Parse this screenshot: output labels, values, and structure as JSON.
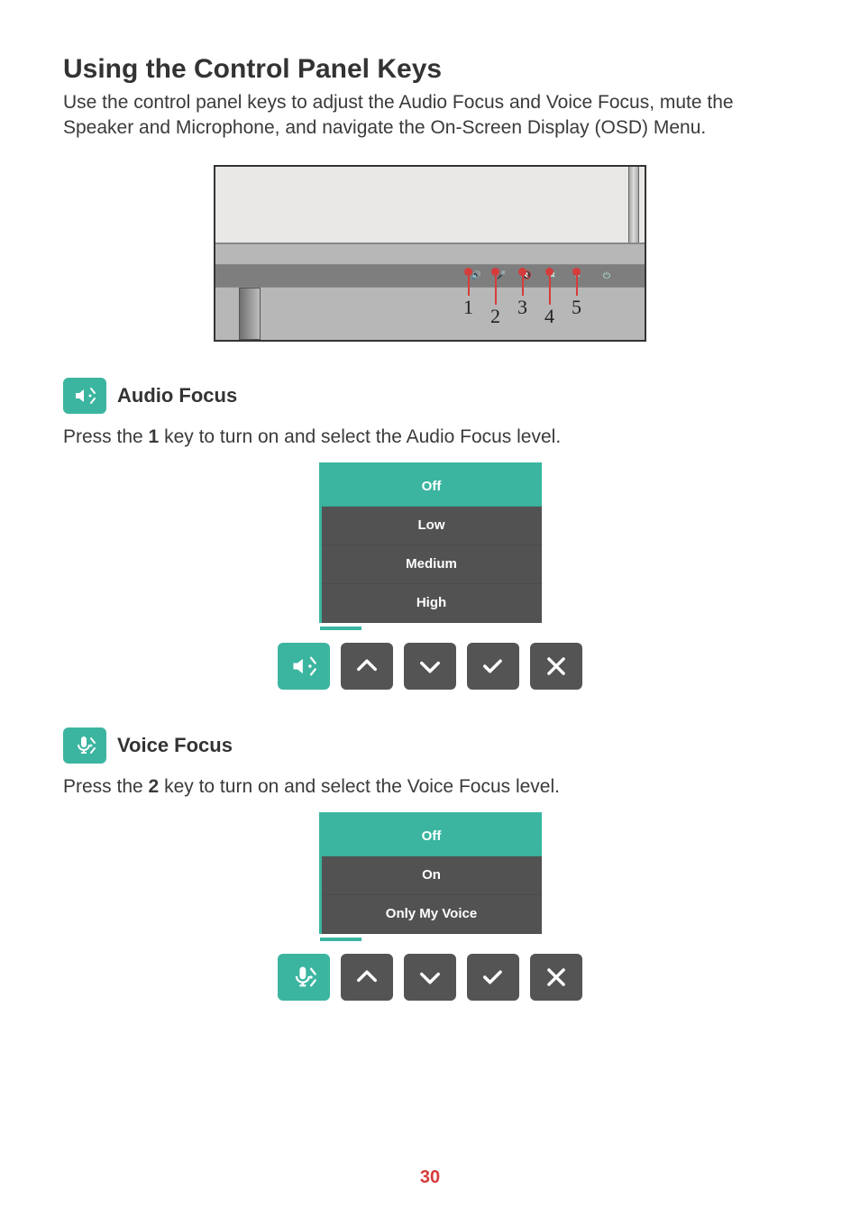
{
  "page_number": "30",
  "heading": "Using the Control Panel Keys",
  "intro": "Use the control panel keys to adjust the Audio Focus and Voice Focus, mute the Speaker and Microphone, and navigate the On-Screen Display (OSD) Menu.",
  "diagram": {
    "callout_labels": [
      "1",
      "2",
      "3",
      "4",
      "5"
    ],
    "panel_icons": [
      "speaker-focus-icon",
      "mic-focus-icon",
      "speaker-mute-icon",
      "mic-mute-icon",
      "menu-icon"
    ],
    "power_icon": "power-icon"
  },
  "sections": [
    {
      "id": "audio_focus",
      "icon": "speaker-focus-icon",
      "title": "Audio Focus",
      "body_pre": "Press the ",
      "body_key": "1",
      "body_post": " key to turn on and select the Audio Focus level.",
      "osd": {
        "items": [
          {
            "label": "Off",
            "selected": true
          },
          {
            "label": "Low",
            "selected": false
          },
          {
            "label": "Medium",
            "selected": false
          },
          {
            "label": "High",
            "selected": false
          }
        ],
        "active_button_icon": "speaker-focus-icon",
        "nav_buttons": [
          "up-icon",
          "down-icon",
          "check-icon",
          "close-icon"
        ]
      }
    },
    {
      "id": "voice_focus",
      "icon": "mic-focus-icon",
      "title": "Voice Focus",
      "body_pre": "Press the ",
      "body_key": "2",
      "body_post": " key to turn on and select the Voice Focus level.",
      "osd": {
        "items": [
          {
            "label": "Off",
            "selected": true
          },
          {
            "label": "On",
            "selected": false
          },
          {
            "label": "Only My Voice",
            "selected": false
          }
        ],
        "active_button_icon": "mic-focus-icon",
        "nav_buttons": [
          "up-icon",
          "down-icon",
          "check-icon",
          "close-icon"
        ]
      }
    }
  ]
}
